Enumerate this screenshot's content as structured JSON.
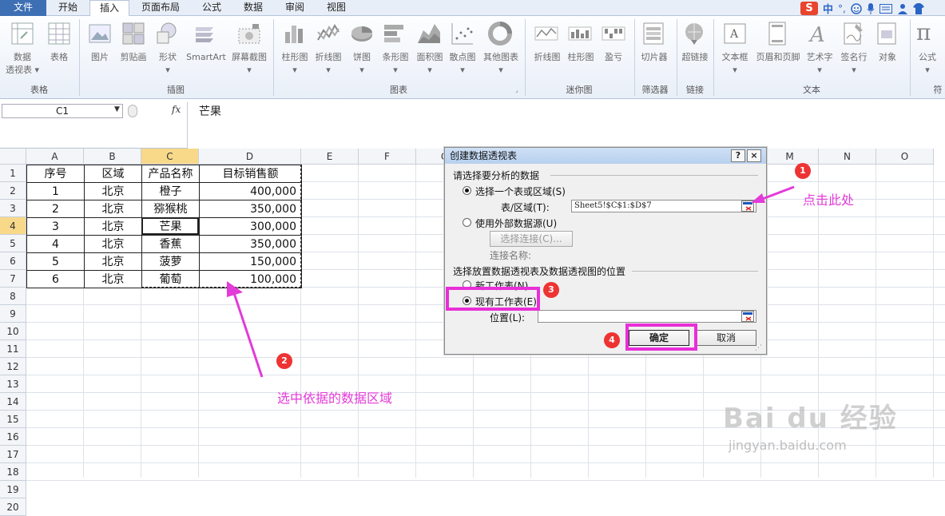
{
  "tabs": [
    {
      "label": "文件",
      "name": "tab-file"
    },
    {
      "label": "开始",
      "name": "tab-home"
    },
    {
      "label": "插入",
      "name": "tab-insert"
    },
    {
      "label": "页面布局",
      "name": "tab-page-layout"
    },
    {
      "label": "公式",
      "name": "tab-formulas"
    },
    {
      "label": "数据",
      "name": "tab-data"
    },
    {
      "label": "审阅",
      "name": "tab-review"
    },
    {
      "label": "视图",
      "name": "tab-view"
    }
  ],
  "ime": {
    "lang": "中",
    "punct": "°,"
  },
  "ribbon": {
    "groups": {
      "tables": "表格",
      "illustrations": "插图",
      "charts": "图表",
      "sparklines": "迷你图",
      "filter": "筛选器",
      "links": "链接",
      "text": "文本",
      "symbols": "符"
    },
    "buttons": {
      "pivot_line1": "数据",
      "pivot_line2": "透视表",
      "table": "表格",
      "picture": "图片",
      "clipart": "剪贴画",
      "shapes": "形状",
      "smartart": "SmartArt",
      "screenshot": "屏幕截图",
      "column": "柱形图",
      "line": "折线图",
      "pie": "饼图",
      "bar": "条形图",
      "area": "面积图",
      "scatter": "散点图",
      "other": "其他图表",
      "spark_line": "折线图",
      "spark_column": "柱形图",
      "winloss": "盈亏",
      "slicer": "切片器",
      "hyperlink": "超链接",
      "textbox": "文本框",
      "header_footer": "页眉和页脚",
      "wordart": "艺术字",
      "signature": "签名行",
      "object": "对象",
      "formula": "公式"
    }
  },
  "formula_bar": {
    "name_box": "C1",
    "fx": "fx",
    "content": "芒果"
  },
  "sheet": {
    "columns": [
      "A",
      "B",
      "C",
      "D",
      "E",
      "F",
      "G",
      "H",
      "I",
      "J",
      "K",
      "L",
      "M",
      "N",
      "O"
    ],
    "rows": [
      "1",
      "2",
      "3",
      "4",
      "5",
      "6",
      "7",
      "8",
      "9",
      "10",
      "11",
      "12",
      "13",
      "14",
      "15",
      "16",
      "17",
      "18",
      "19",
      "20"
    ],
    "header": [
      "序号",
      "区域",
      "产品名称",
      "目标销售额"
    ],
    "data": [
      [
        "1",
        "北京",
        "橙子",
        "400,000"
      ],
      [
        "2",
        "北京",
        "猕猴桃",
        "350,000"
      ],
      [
        "3",
        "北京",
        "芒果",
        "300,000"
      ],
      [
        "4",
        "北京",
        "香蕉",
        "350,000"
      ],
      [
        "5",
        "北京",
        "菠萝",
        "150,000"
      ],
      [
        "6",
        "北京",
        "葡萄",
        "100,000"
      ]
    ]
  },
  "dialog": {
    "title": "创建数据透视表",
    "help": "?",
    "close": "×",
    "section1": "请选择要分析的数据",
    "opt_table": "选择一个表或区域(S)",
    "range_label": "表/区域(T):",
    "range_value": "Sheet5!$C$1:$D$7",
    "opt_external": "使用外部数据源(U)",
    "choose_conn": "选择连接(C)...",
    "conn_name": "连接名称:",
    "section2": "选择放置数据透视表及数据透视图的位置",
    "opt_new": "新工作表(N)",
    "opt_existing": "现有工作表(E)",
    "location_label": "位置(L):",
    "location_value": "",
    "ok": "确定",
    "cancel": "取消"
  },
  "annotations": {
    "n1": "1",
    "n2": "2",
    "n3": "3",
    "n4": "4",
    "click_here": "点击此处",
    "select_range": "选中依据的数据区域"
  },
  "watermark": {
    "logo": "Bai du 经验",
    "url": "jingyan.baidu.com"
  },
  "colors": {
    "accent": "#e82fd8",
    "badge": "#e33333",
    "selected_header": "#f8d98a",
    "file_tab": "#3d6fb4"
  }
}
